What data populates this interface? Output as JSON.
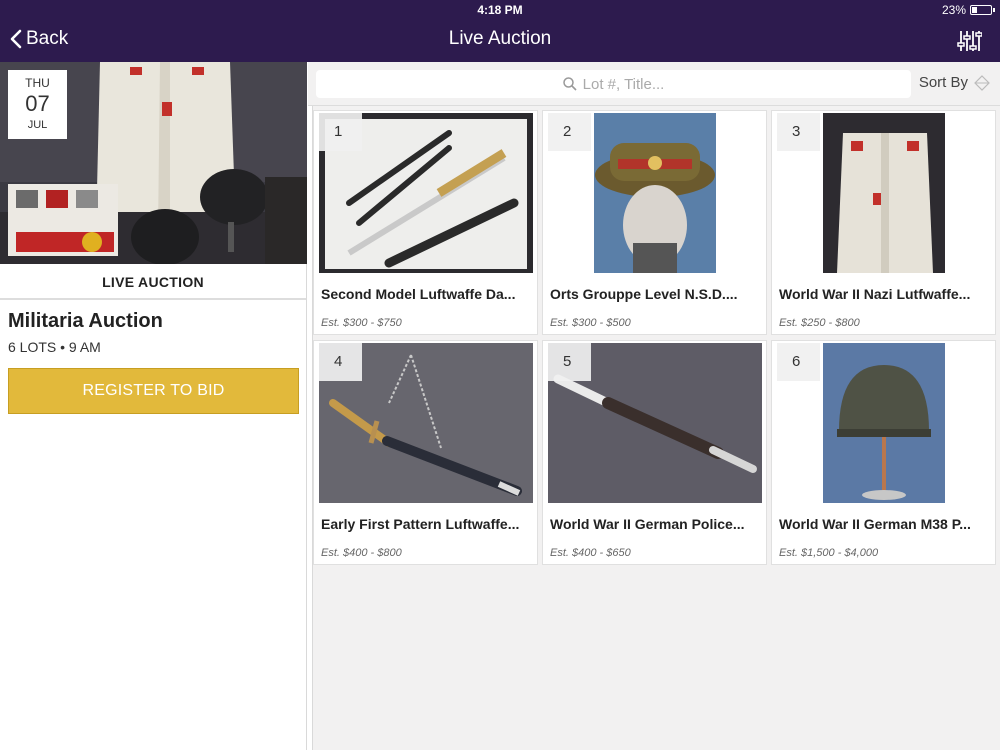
{
  "status_bar": {
    "device": "iPad",
    "time": "4:18 PM",
    "battery": "23%"
  },
  "nav": {
    "back_label": "Back",
    "title": "Live Auction"
  },
  "auction": {
    "date": {
      "weekday": "THU",
      "day": "07",
      "month": "JUL"
    },
    "type_label": "LIVE AUCTION",
    "title": "Militaria Auction",
    "meta": "6 LOTS • 9 AM",
    "register_label": "REGISTER TO BID"
  },
  "search": {
    "placeholder": "Lot #, Title...",
    "sort_label": "Sort By"
  },
  "lots": [
    {
      "number": "1",
      "title": "Second Model Luftwaffe Da...",
      "estimate": "Est. $300 - $750"
    },
    {
      "number": "2",
      "title": "Orts Grouppe Level N.S.D....",
      "estimate": "Est. $300 - $500"
    },
    {
      "number": "3",
      "title": "World War II Nazi Lutfwaffe...",
      "estimate": "Est. $250 - $800"
    },
    {
      "number": "4",
      "title": "Early First Pattern Luftwaffe...",
      "estimate": "Est. $400 - $800"
    },
    {
      "number": "5",
      "title": "World War II German Police...",
      "estimate": "Est. $400 - $650"
    },
    {
      "number": "6",
      "title": "World War II German M38 P...",
      "estimate": "Est. $1,500 - $4,000"
    }
  ],
  "colors": {
    "header_bg": "#2d1b4e",
    "accent": "#e2b93b"
  }
}
